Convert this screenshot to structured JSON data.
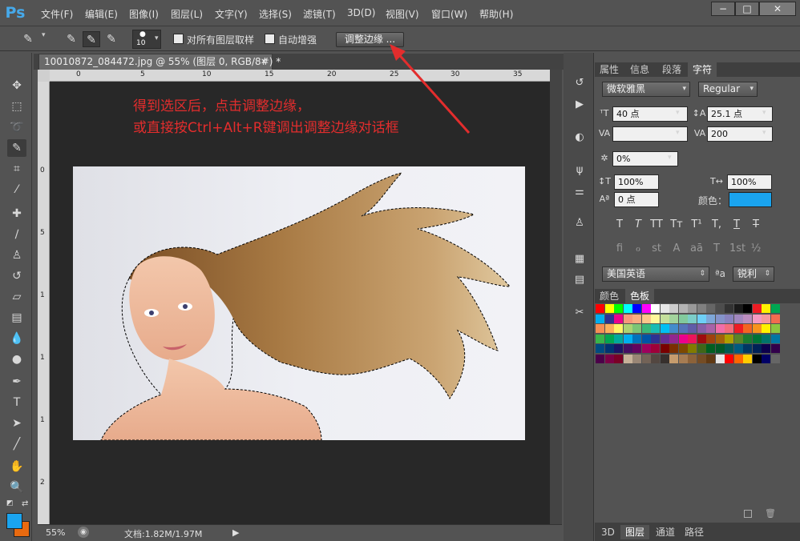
{
  "app": {
    "logo": "Ps"
  },
  "menu": [
    "文件(F)",
    "编辑(E)",
    "图像(I)",
    "图层(L)",
    "文字(Y)",
    "选择(S)",
    "滤镜(T)",
    "3D(D)",
    "视图(V)",
    "窗口(W)",
    "帮助(H)"
  ],
  "window_buttons": {
    "minimize": "−",
    "restore": "□",
    "close": "✕"
  },
  "options_bar": {
    "brush_size": "10",
    "sample_all_layers_label": "对所有图层取样",
    "sample_all_layers_checked": false,
    "auto_enhance_label": "自动增强",
    "auto_enhance_checked": false,
    "refine_edge_label": "调整边缘 ..."
  },
  "document": {
    "tab_title": "10010872_084472.jpg @ 55% (图层 0, RGB/8#) *",
    "tab_close": "✕",
    "ruler_ticks": [
      "0",
      "5",
      "10",
      "15",
      "20",
      "25",
      "30",
      "35"
    ],
    "ruler_left_ticks": [
      "0",
      "5",
      "1",
      "1",
      "1",
      "2",
      "2",
      "3"
    ]
  },
  "annotation": {
    "line1": "得到选区后，点击调整边缘，",
    "line2": "或直接按Ctrl+Alt+R键调出调整边缘对话框",
    "color": "#e32d2d"
  },
  "status": {
    "zoom": "55%",
    "doc_info": "文档:1.82M/1.97M",
    "arrow": "▶"
  },
  "character_panel": {
    "tabs": [
      "属性",
      "信息",
      "段落",
      "字符"
    ],
    "active_tab": "字符",
    "font_family": "微软雅黑",
    "font_style": "Regular",
    "font_size": "40 点",
    "leading": "25.1 点",
    "kerning": "",
    "tracking": "200",
    "tsume": "0%",
    "vertical_scale": "100%",
    "horizontal_scale": "100%",
    "baseline_shift": "0 点",
    "color_label": "颜色：",
    "text_color": "#1aa4ef",
    "style_buttons": [
      "T",
      "T",
      "TT",
      "Tт",
      "T¹",
      "T,",
      "T",
      "T"
    ],
    "opentype_buttons": [
      "fi",
      "ℴ",
      "st",
      "A",
      "aā",
      "T",
      "1st",
      "½"
    ],
    "language": "美国英语",
    "aa_label": "ªa",
    "antialias": "锐利"
  },
  "swatch_panel": {
    "tabs": [
      "颜色",
      "色板"
    ],
    "active_tab": "色板"
  },
  "layers_panel": {
    "tabs": [
      "3D",
      "图层",
      "通道",
      "路径"
    ],
    "active_tab": "图层"
  },
  "tool_colors": {
    "foreground": "#1aa4ef",
    "background": "#e86a10"
  }
}
